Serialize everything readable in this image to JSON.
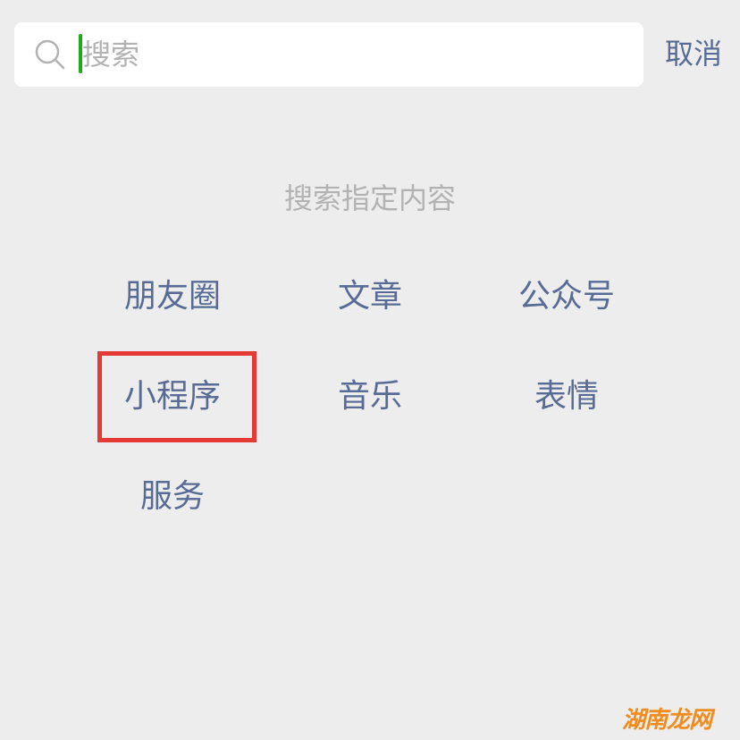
{
  "search": {
    "placeholder": "搜索",
    "cancel_label": "取消"
  },
  "hint": "搜索指定内容",
  "categories": [
    {
      "label": "朋友圈"
    },
    {
      "label": "文章"
    },
    {
      "label": "公众号"
    },
    {
      "label": "小程序"
    },
    {
      "label": "音乐"
    },
    {
      "label": "表情"
    },
    {
      "label": "服务"
    }
  ],
  "watermark": "湖南龙网",
  "colors": {
    "background": "#ededed",
    "link": "#576b95",
    "cursor": "#1aad19",
    "highlight": "#e53935",
    "placeholder": "#b2b2b2"
  }
}
